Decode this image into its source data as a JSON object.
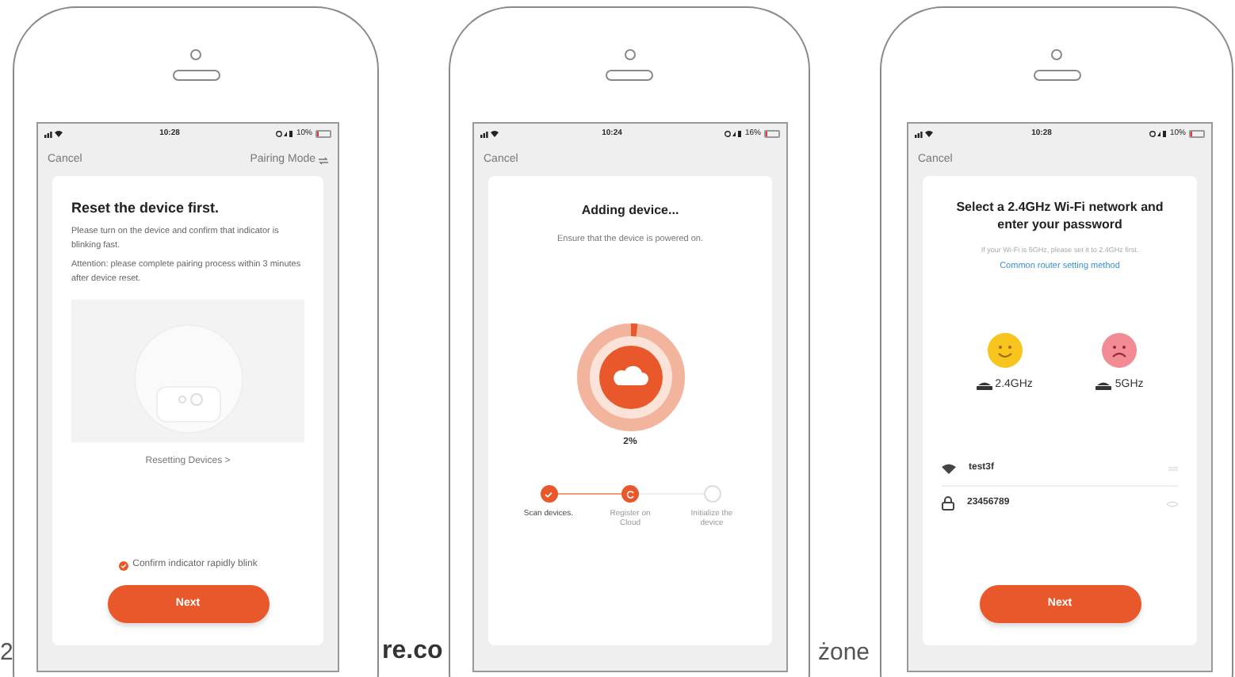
{
  "page_text": [
    "2",
    "re.co",
    "żone"
  ],
  "phones": [
    {
      "kind": "reset",
      "status": {
        "time": "10:28",
        "battery": "10%"
      },
      "nav": {
        "left": "Cancel",
        "right": "Pairing Mode"
      },
      "title": "Reset the device first.",
      "paragraphs": [
        "Please turn on the device and confirm that indicator is blinking fast.",
        "Attention: please complete pairing process within 3 minutes after device reset."
      ],
      "link": "Resetting Devices >",
      "confirm": {
        "label": "Confirm indicator rapidly blink",
        "checked": true
      },
      "button": "Next"
    },
    {
      "kind": "adding",
      "status": {
        "time": "10:24",
        "battery": "16%"
      },
      "nav": {
        "left": "Cancel"
      },
      "title": "Adding device...",
      "subtitle": "Ensure that the device is powered on.",
      "progress": {
        "level": 0.02,
        "reading": "2%"
      },
      "steps": [
        {
          "label": "Scan devices.",
          "kind": "done"
        },
        {
          "label": "Register on Cloud",
          "kind": "current"
        },
        {
          "label": "Initialize the device",
          "kind": "pending"
        }
      ]
    },
    {
      "kind": "wifi",
      "status": {
        "time": "10:28",
        "battery": "10%"
      },
      "nav": {
        "left": "Cancel"
      },
      "title": "Select a 2.4GHz Wi-Fi network and enter your password",
      "hint": "If your Wi-Fi is 5GHz, please set it to 2.4GHz first.",
      "link": "Common router setting method",
      "bands": [
        {
          "label": "2.4GHz",
          "kind": "happy"
        },
        {
          "label": "5GHz",
          "kind": "sad"
        }
      ],
      "ssid": "test3f",
      "password": "23456789",
      "button": "Next"
    }
  ]
}
